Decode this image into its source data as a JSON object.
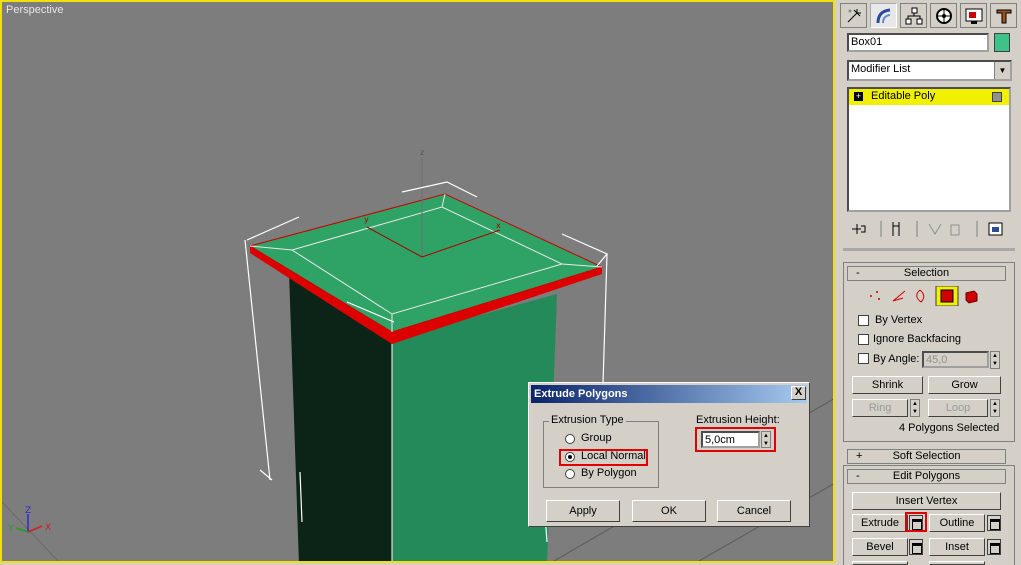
{
  "viewport": {
    "label": "Perspective",
    "axis_z_label": "Z",
    "axis_x_label": "X",
    "axis_y_label": "Y",
    "gizmo": {
      "z": "z",
      "y": "y",
      "x": "x"
    }
  },
  "panel": {
    "tabs": [
      "create-icon",
      "modify-icon",
      "hierarchy-icon",
      "motion-icon",
      "display-icon",
      "utilities-icon"
    ],
    "object_name": "Box01",
    "object_color": "#3ec28a",
    "modifier_list": "Modifier List",
    "stack_item": "Editable Poly",
    "selection": {
      "title": "Selection",
      "by_vertex": "By Vertex",
      "ignore_backfacing": "Ignore Backfacing",
      "by_angle": "By Angle:",
      "by_angle_value": "45,0",
      "shrink": "Shrink",
      "grow": "Grow",
      "ring": "Ring",
      "loop": "Loop",
      "status": "4 Polygons Selected"
    },
    "soft_selection": {
      "title": "Soft Selection"
    },
    "edit_polygons": {
      "title": "Edit Polygons",
      "insert_vertex": "Insert Vertex",
      "extrude": "Extrude",
      "outline": "Outline",
      "bevel": "Bevel",
      "inset": "Inset"
    }
  },
  "dialog": {
    "title": "Extrude Polygons",
    "close": "X",
    "extrusion_type": "Extrusion Type",
    "group": "Group",
    "local_normal": "Local Normal",
    "by_polygon": "By Polygon",
    "extrusion_height_label": "Extrusion Height:",
    "extrusion_height_value": "5,0cm",
    "apply": "Apply",
    "ok": "OK",
    "cancel": "Cancel"
  }
}
